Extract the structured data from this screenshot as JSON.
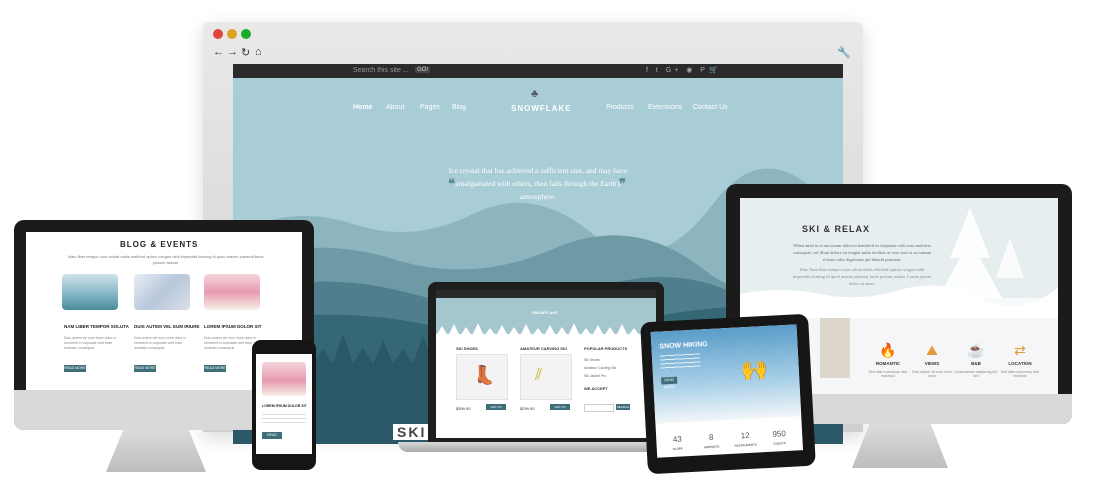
{
  "browser": {
    "search_placeholder": "Search this site ...",
    "go_label": "GO!",
    "social_icons": "f t G+ ◉ P",
    "nav_left": [
      "Home",
      "About",
      "Pages",
      "Blog"
    ],
    "logo": "SNOWFLAKE",
    "nav_right": [
      "Products",
      "Extensions",
      "Contact Us"
    ],
    "quote": "Ice crystal that has achieved a sufficient size, and may have amalgamated with others, then falls through the Earth's atmosphere.",
    "bottom_heading": "SKI &"
  },
  "imac_right": {
    "title": "SKI & RELAX",
    "text": "When amet in et ancorsum dolor in hendrerit in vulputate velit esse molestie consequat, vel illum dolore eu feugiat nulla facilisis at vero eros et accumsan et iusto odio dignissim qui blandit praesent.",
    "text2": "Duis Nam liber tempor cum soluta nobis eleifend option congue nihil imperdiet doming id quod mazim placerat facer possim assum. Lorem ipsum dolor sit amet.",
    "features": [
      {
        "icon": "campfire-icon",
        "glyph": "🔥",
        "label": "ROMANTIC",
        "desc": "Sed diam nonummy nibh euismod"
      },
      {
        "icon": "mountain-icon",
        "glyph": "⛰",
        "label": "VIEWS",
        "desc": "Duis autem vel eum iriure dolor"
      },
      {
        "icon": "coffee-icon",
        "glyph": "☕",
        "label": "B&B",
        "desc": "Consectetuer adipiscing elit, sed"
      },
      {
        "icon": "signpost-icon",
        "glyph": "⇄",
        "label": "LOCATION",
        "desc": "Sed diam nonummy nibh euismod"
      }
    ]
  },
  "imac_left": {
    "title": "BLOG & EVENTS",
    "subtitle": "Nam liber tempor cum soluta nobis eleifend option congue nihil imperdiet doming id quod mazim placerat facer possim assum.",
    "posts": [
      {
        "title": "NAM LIBER TEMPOR SOLUTA",
        "text": "Duis autem vel eum iriure dolor in hendrerit in vulputate velit esse molestie consequat.",
        "button": "READ MORE"
      },
      {
        "title": "DUIS AUTEM VEL EUM IRIURE",
        "text": "Duis autem vel eum iriure dolor in hendrerit in vulputate velit esse molestie consequat.",
        "button": "READ MORE"
      },
      {
        "title": "LOREM IPSUM DOLOR SIT",
        "text": "Duis autem vel eum iriure dolor in hendrerit in vulputate velit esse molestie consequat.",
        "button": "READ MORE"
      }
    ]
  },
  "laptop": {
    "logo": "SNOWFLAKE",
    "products": [
      {
        "name": "SKI SHOES",
        "price": "$399.00",
        "button": "ADD TO CART"
      },
      {
        "name": "AMATEUR CARVING SKI",
        "price": "$299.00",
        "button": "ADD TO CART"
      }
    ],
    "sidebar_heading": "POPULAR PRODUCTS",
    "sidebar_items": [
      "Ski Shoes",
      "Amateur Carving Ski",
      "Ski Jacket Pro"
    ],
    "accept_heading": "WE ACCEPT",
    "search_button": "SEARCH"
  },
  "phone": {
    "post_title": "LOREM IPSUM DOLOR SIT",
    "button": "READ MORE"
  },
  "tablet": {
    "title": "SNOW HIKING",
    "button": "READ MORE",
    "stats": [
      {
        "value": "43",
        "label": "SLOPE"
      },
      {
        "value": "8",
        "label": "AIRPORTS"
      },
      {
        "value": "12",
        "label": "RESTAURANTS"
      },
      {
        "value": "950",
        "label": "GUESTS"
      }
    ]
  }
}
